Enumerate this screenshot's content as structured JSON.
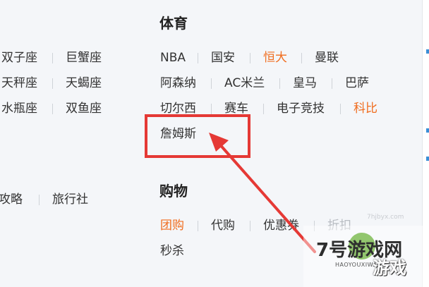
{
  "zodiac": {
    "rows": [
      [
        "双子座",
        "巨蟹座"
      ],
      [
        "天秤座",
        "天蝎座"
      ],
      [
        "水瓶座",
        "双鱼座"
      ]
    ]
  },
  "travel": {
    "items": [
      "攻略",
      "旅行社"
    ]
  },
  "sports": {
    "title": "体育",
    "rows": [
      [
        "NBA",
        "国安",
        "恒大",
        "曼联"
      ],
      [
        "阿森纳",
        "AC米兰",
        "皇马",
        "巴萨"
      ],
      [
        "切尔西",
        "赛车",
        "电子竞技",
        "科比"
      ],
      [
        "詹姆斯"
      ]
    ]
  },
  "shopping": {
    "title": "购物",
    "rows": [
      [
        "团购",
        "代购",
        "优惠券",
        "折扣"
      ],
      [
        "秒杀"
      ]
    ]
  },
  "watermark": {
    "domain": "7hjbyx.com",
    "brand_number": "7号",
    "brand_cn": "游戏网",
    "brand_pinyin": "HAOYOUXIWANG",
    "brand_game": "游戏"
  },
  "colors": {
    "highlight_text": "#f06d1f",
    "annotation_red": "#e53935"
  }
}
